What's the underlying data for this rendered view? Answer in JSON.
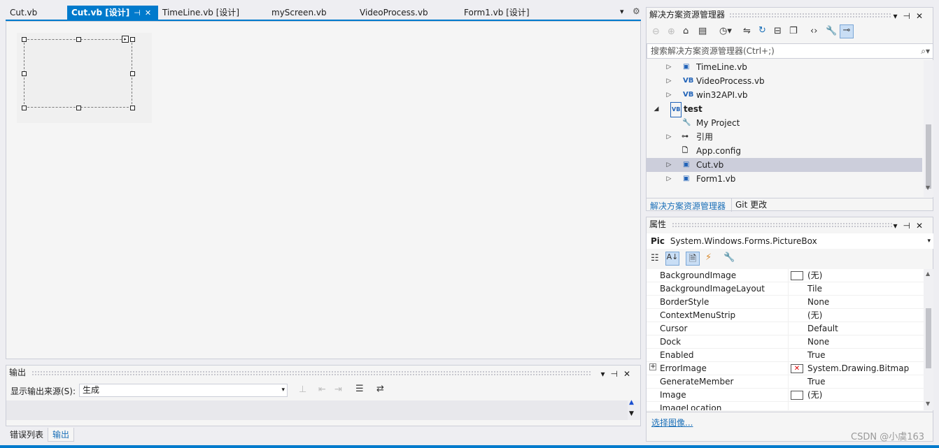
{
  "tabs": [
    {
      "label": "Cut.vb"
    },
    {
      "label": "Cut.vb [设计]"
    },
    {
      "label": "TimeLine.vb [设计]"
    },
    {
      "label": "myScreen.vb"
    },
    {
      "label": "VideoProcess.vb"
    },
    {
      "label": "Form1.vb [设计]"
    }
  ],
  "output": {
    "title": "输出",
    "source_label": "显示输出来源(S):",
    "source_value": "生成"
  },
  "bottom_tabs": [
    {
      "label": "错误列表"
    },
    {
      "label": "输出"
    }
  ],
  "solution_explorer": {
    "title": "解决方案资源管理器",
    "search_placeholder": "搜索解决方案资源管理器(Ctrl+;)",
    "items": [
      {
        "label": "TimeLine.vb",
        "icon": "form-icon",
        "expander": "collapsed"
      },
      {
        "label": "VideoProcess.vb",
        "icon": "vb-file-icon",
        "expander": "collapsed"
      },
      {
        "label": "win32API.vb",
        "icon": "vb-file-icon",
        "expander": "collapsed"
      },
      {
        "label": "test",
        "icon": "vb-project-icon",
        "expander": "expanded"
      },
      {
        "label": "My Project",
        "icon": "wrench-icon",
        "expander": "none"
      },
      {
        "label": "引用",
        "icon": "references-icon",
        "expander": "collapsed"
      },
      {
        "label": "App.config",
        "icon": "config-file-icon",
        "expander": "none"
      },
      {
        "label": "Cut.vb",
        "icon": "form-icon",
        "expander": "collapsed",
        "selected": true
      },
      {
        "label": "Form1.vb",
        "icon": "form-icon",
        "expander": "collapsed"
      }
    ],
    "bottom_tabs": [
      {
        "label": "解决方案资源管理器"
      },
      {
        "label": "Git 更改"
      }
    ]
  },
  "properties": {
    "title": "属性",
    "object_name": "Pic",
    "object_type": "System.Windows.Forms.PictureBox",
    "rows": [
      {
        "name": "BackgroundImage",
        "value": "(无)",
        "swatch": "blank"
      },
      {
        "name": "BackgroundImageLayout",
        "value": "Tile"
      },
      {
        "name": "BorderStyle",
        "value": "None"
      },
      {
        "name": "ContextMenuStrip",
        "value": "(无)"
      },
      {
        "name": "Cursor",
        "value": "Default"
      },
      {
        "name": "Dock",
        "value": "None"
      },
      {
        "name": "Enabled",
        "value": "True"
      },
      {
        "name": "ErrorImage",
        "value": "System.Drawing.Bitmap",
        "swatch": "error"
      },
      {
        "name": "GenerateMember",
        "value": "True"
      },
      {
        "name": "Image",
        "value": "(无)",
        "swatch": "blank"
      },
      {
        "name": "ImageLocation",
        "value": ""
      }
    ],
    "link": "选择图像..."
  },
  "watermark": "CSDN @小虞163",
  "colors": {
    "accent": "#007acc",
    "selection": "#cccedb",
    "panel": "#f5f5f5",
    "link": "#1a6fb8"
  }
}
